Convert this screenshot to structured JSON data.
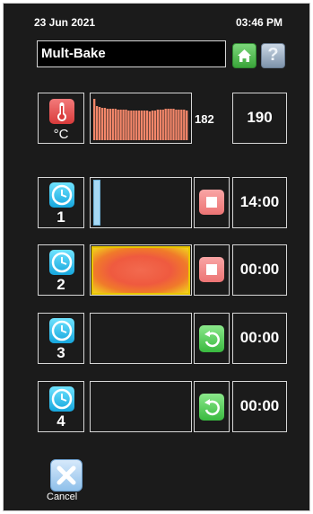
{
  "status_bar": {
    "date": "23 Jun 2021",
    "time": "03:46 PM"
  },
  "header": {
    "program_name": "Mult-Bake",
    "home_icon": "home-icon",
    "help_icon": "help-icon"
  },
  "temperature": {
    "icon": "thermometer-icon",
    "unit": "°C",
    "current": "182",
    "setpoint": "190",
    "history_color": "#f4876a"
  },
  "timers": [
    {
      "number": "1",
      "icon": "clock-icon",
      "control": "stop",
      "control_icon": "stop-icon",
      "time": "14:00",
      "progress": 0.07,
      "state": "running"
    },
    {
      "number": "2",
      "icon": "clock-icon",
      "control": "stop",
      "control_icon": "stop-icon",
      "time": "00:00",
      "progress": 1.0,
      "state": "finished"
    },
    {
      "number": "3",
      "icon": "clock-icon",
      "control": "restart",
      "control_icon": "restart-icon",
      "time": "00:00",
      "progress": 0,
      "state": "idle"
    },
    {
      "number": "4",
      "icon": "clock-icon",
      "control": "restart",
      "control_icon": "restart-icon",
      "time": "00:00",
      "progress": 0,
      "state": "idle"
    }
  ],
  "footer": {
    "cancel_label": "Cancel",
    "cancel_icon": "cancel-icon"
  }
}
